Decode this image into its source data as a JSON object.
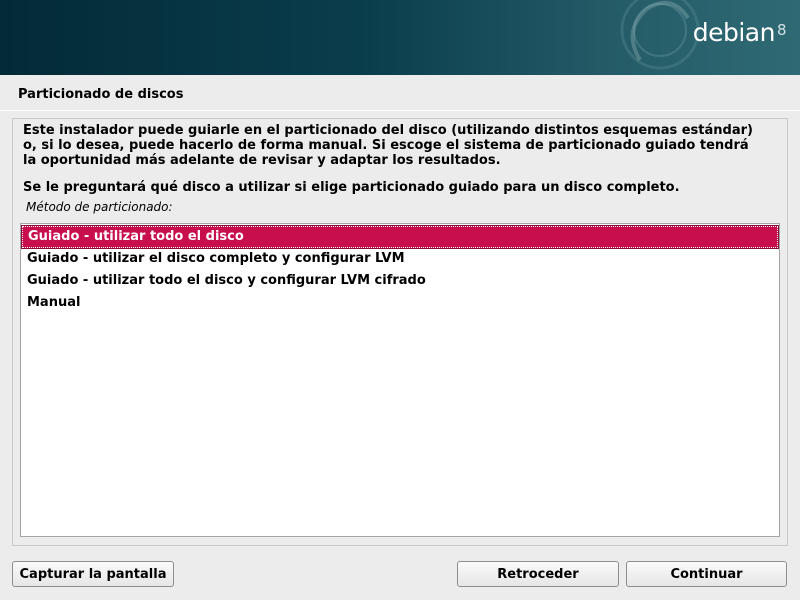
{
  "banner": {
    "logo_text": "debian",
    "version": "8"
  },
  "page": {
    "title": "Particionado de discos"
  },
  "content": {
    "description": "Este instalador puede guiarle en el particionado del disco (utilizando distintos esquemas estándar) o, si lo desea, puede hacerlo de forma manual. Si escoge el sistema de particionado guiado tendrá la oportunidad más adelante de revisar y adaptar los resultados.",
    "note": "Se le preguntará qué disco a utilizar si elige particionado guiado para un disco completo.",
    "list_label": "Método de particionado:",
    "options": [
      {
        "label": "Guiado - utilizar todo el disco",
        "selected": true
      },
      {
        "label": "Guiado - utilizar el disco completo y configurar LVM",
        "selected": false
      },
      {
        "label": "Guiado - utilizar todo el disco y configurar LVM cifrado",
        "selected": false
      },
      {
        "label": "Manual",
        "selected": false
      }
    ]
  },
  "buttons": {
    "capture": "Capturar la pantalla",
    "back": "Retroceder",
    "continue": "Continuar"
  },
  "colors": {
    "banner_dark": "#032a37",
    "banner_light": "#2f6a74",
    "selection": "#c80e4c",
    "background": "#ececec"
  }
}
